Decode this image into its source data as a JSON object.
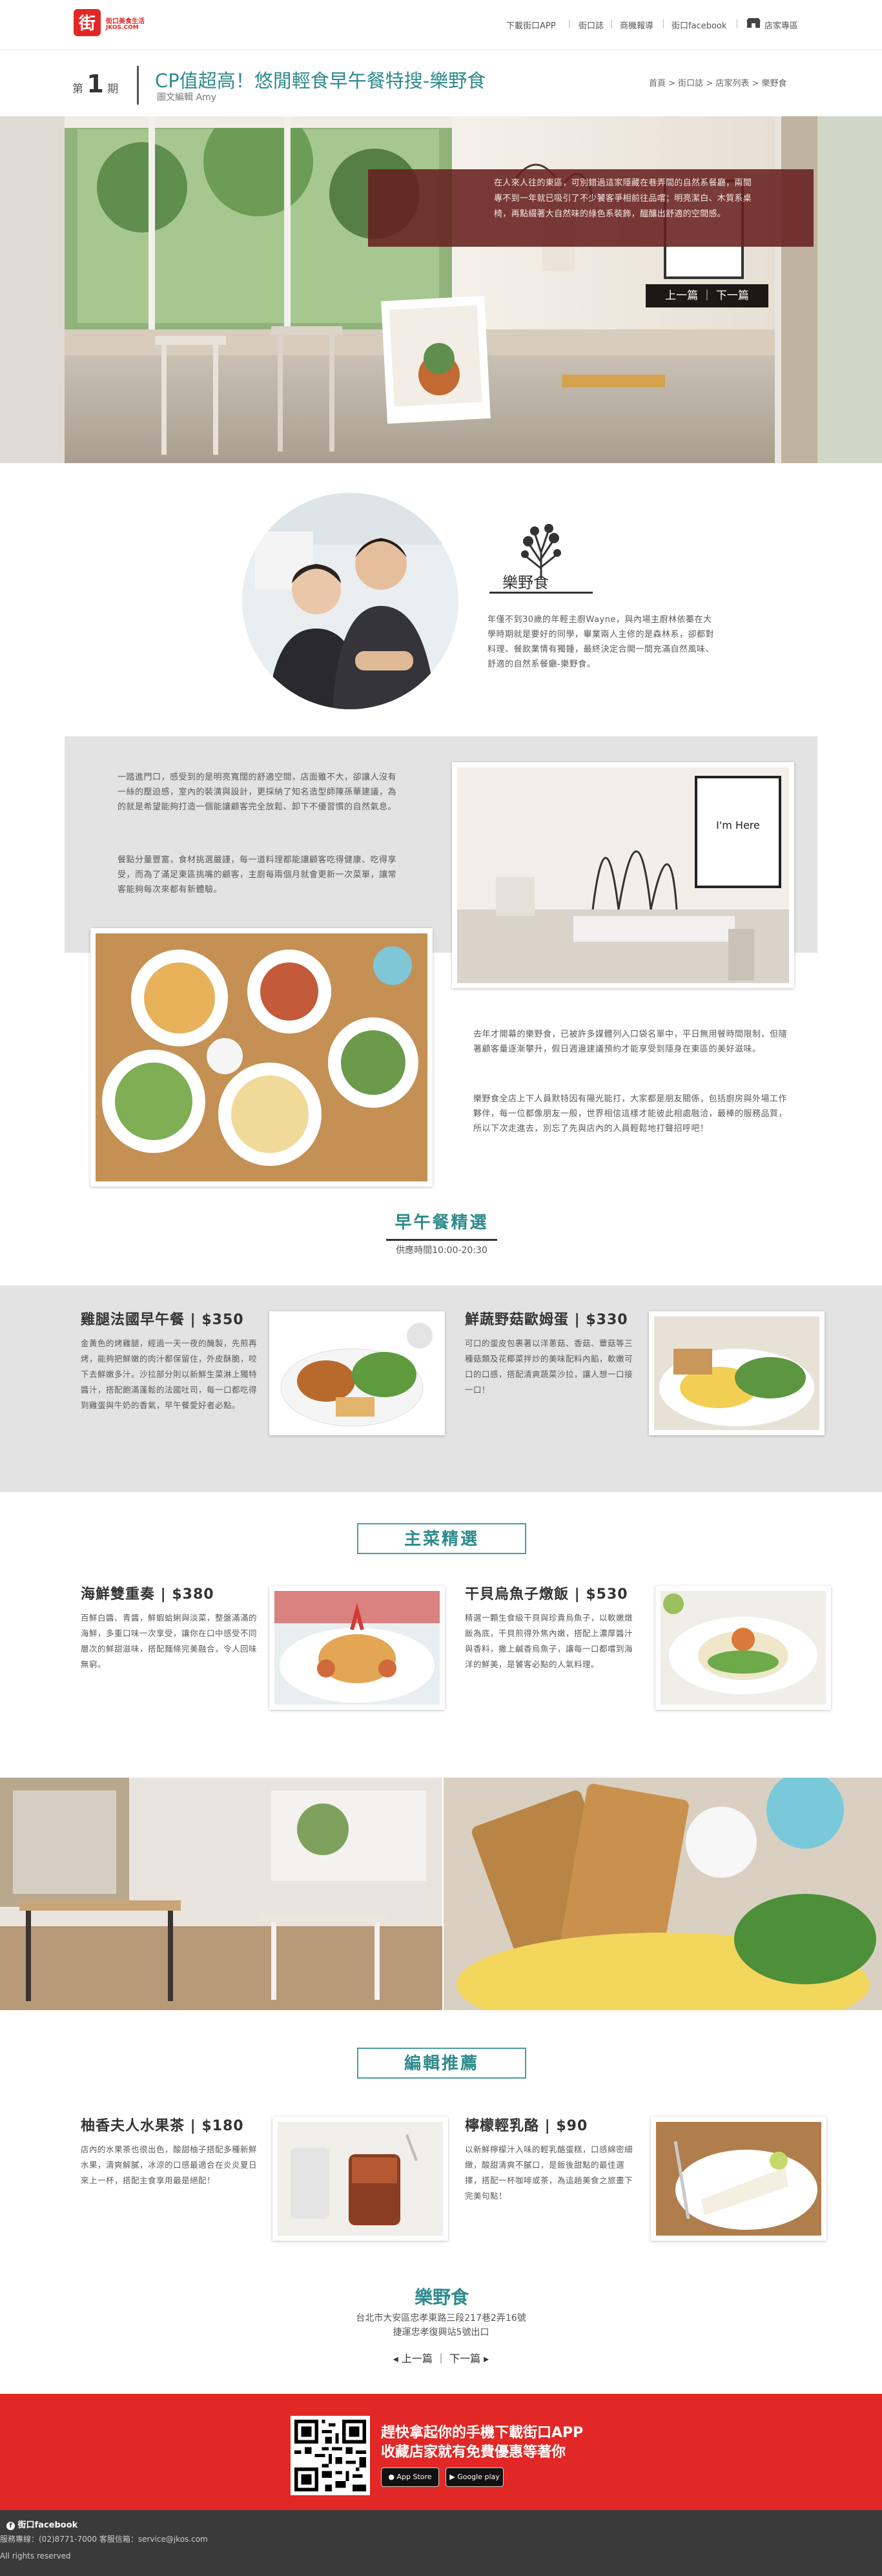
{
  "header": {
    "logo_text": "街口美食生活",
    "logo_domain": "JKOS.COM",
    "nav": [
      "下載街口APP",
      "街口誌",
      "商機報導",
      "街口facebook",
      "店家專區"
    ]
  },
  "article": {
    "issue_prefix": "第",
    "issue_number": "1",
    "issue_suffix": "期",
    "title": "CP值超高！悠閒輕食早午餐特搜-樂野食",
    "author": "圖文編輯 Amy",
    "breadcrumb": "首頁 > 街口誌 > 店家列表 > 樂野食"
  },
  "hero": {
    "nav_label": "上一篇 ｜ 下一篇",
    "description": "在人來人往的東區，可別錯過這家隱藏在巷弄間的自然系餐廳，兩間專不到一年就已吸引了不少饕客爭相前往品嚐；明亮潔白、木質系桌椅，再點綴著大自然味的綠色系裝飾，醞釀出舒適的空間感。"
  },
  "owner": {
    "brand_name": "樂野食",
    "description": "年僅不到30歲的年輕主廚Wayne，與內場主廚林依蓁在大學時期就是要好的同學，畢業兩人主修的是森林系，卻都對料理、餐飲業情有獨鍾，最終決定合開一間充滿自然風味、舒適的自然系餐廳-樂野食。"
  },
  "intro": {
    "p1": "一踏進門口，感受到的是明亮寬闊的舒適空間，店面雖不大，卻讓人沒有一絲的壓迫感，室內的裝潢與設計，更採納了知名造型師陳孫華建議，為的就是希望能夠打造一個能讓顧客完全放鬆、卸下不優習慣的自然氣息。",
    "p2": "餐點分量豐富，食材挑選嚴謹，每一道料理都能讓顧客吃得健康、吃得享受，而為了滿足東區挑嘴的顧客，主廚每兩個月就會更新一次菜單，讓常客能夠每次來都有新體驗。",
    "p3": "去年才開幕的樂野食，已被許多媒體列入口袋名單中，平日無用餐時間限制，但隨著顧客量逐漸攀升，假日週邊建議預約才能享受到隱身在東區的美好滋味。",
    "p4": "樂野食全店上下人員默特因有陽光能打，大家都是朋友關係，包括廚房與外場工作夥伴，每一位都像朋友一般，世界相信這樣才能彼此相處融洽，最棒的服務品質，所以下次走進去，別忘了先與店內的人員輕鬆地打聲招呼吧！"
  },
  "breakfast": {
    "heading": "早午餐精選",
    "hours": "供應時間10:00-20:30",
    "items": [
      {
        "name": "雞腿法國早午餐 | $350",
        "desc": "金黃色的烤雞腿，經過一天一夜的醃製，先煎再烤，能夠把鮮嫩的肉汁都保留住，外皮酥脆，咬下去鮮嫩多汁。沙拉部分則以新鮮生菜淋上獨特醬汁，搭配飽滿蓬鬆的法國吐司，每一口都吃得到雞蛋與牛奶的香氣，早午餐愛好者必點。"
      },
      {
        "name": "鮮蔬野菇歐姆蛋 | $330",
        "desc": "可口的蛋皮包裹著以洋蔥菇、香菇、蕈菇等三種菇類及花椰菜拌炒的美味配料內餡，軟嫩可口的口感，搭配清爽蔬菜沙拉，讓人想一口接一口！"
      }
    ]
  },
  "mains": {
    "heading": "主菜精選",
    "items": [
      {
        "name": "海鮮雙重奏 | $380",
        "desc": "百鮮白醬、青醬，鮮蝦蛤蜊與淡菜，整盤滿滿的海鮮，多重口味一次享受，讓你在口中感受不同層次的鮮甜滋味，搭配麵條完美融合，令人回味無窮。"
      },
      {
        "name": "干貝烏魚子燉飯 | $530",
        "desc": "精選一顆生食級干貝與珍貴烏魚子，以軟嫩燉飯為底，干貝煎得外焦內嫩，搭配上濃厚醬汁與香料，撒上鹹香烏魚子，讓每一口都嚐到海洋的鮮美，是饕客必點的人氣料理。"
      }
    ]
  },
  "editor": {
    "heading": "編輯推薦",
    "items": [
      {
        "name": "柚香夫人水果茶 | $180",
        "desc": "店內的水果茶也很出色，酸甜柚子搭配多種新鮮水果，清爽解膩，冰涼的口感最適合在炎炎夏日來上一杯，搭配主食享用最是絕配！"
      },
      {
        "name": "檸檬輕乳酪 | $90",
        "desc": "以新鮮檸檬汁入味的輕乳酪蛋糕，口感綿密細緻，酸甜清爽不膩口，是飯後甜點的最佳選擇，搭配一杯咖啡或茶，為這趟美食之旅畫下完美句點！"
      }
    ]
  },
  "store": {
    "name": "樂野食",
    "address": "台北市大安區忠孝東路三段217巷2弄16號",
    "near": "捷運忠孝復興站5號出口",
    "nav": "◂ 上一篇 ｜ 下一篇 ▸"
  },
  "app_banner": {
    "line1": "趕快拿起你的手機下載街口APP",
    "line2": "收藏店家就有免費優惠等著你",
    "app_store": "App Store",
    "google_play": "Google play"
  },
  "footer": {
    "facebook": "街口facebook",
    "contact": "服務專線：(02)8771-7000  客服信箱：service@jkos.com",
    "rights": "All rights reserved"
  },
  "colors": {
    "accent": "#2e8a8c",
    "brand_red": "#e12826",
    "hero_box": "#67201e"
  }
}
